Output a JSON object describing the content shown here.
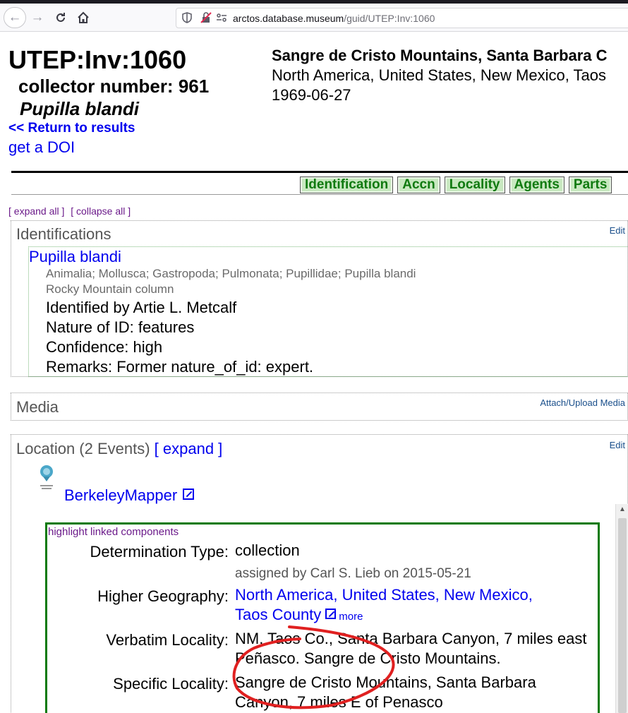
{
  "browser": {
    "url_host": "arctos.database.museum",
    "url_path": "/guid/UTEP:Inv:1060"
  },
  "header": {
    "catalog_number": "UTEP:Inv:1060",
    "collector_number": "collector number: 961",
    "scientific_name": "Pupilla blandi",
    "return_link": "<< Return to results",
    "doi_link": "get a DOI",
    "locality_title": "Sangre de Cristo Mountains, Santa Barbara C",
    "geography": "North America, United States, New Mexico, Taos",
    "date": "1969-06-27"
  },
  "tabs": [
    "Identification",
    "Accn",
    "Locality",
    "Agents",
    "Parts"
  ],
  "expand_all": "[ expand all ]",
  "collapse_all": "[ collapse all ]",
  "identifications": {
    "title": "Identifications",
    "edit": "Edit",
    "name": "Pupilla blandi",
    "taxonomy": "Animalia; Mollusca; Gastropoda; Pulmonata; Pupillidae; Pupilla blandi",
    "common_name": "Rocky Mountain column",
    "identified_by": "Identified by Artie L. Metcalf",
    "nature": "Nature of ID: features",
    "confidence": "Confidence: high",
    "remarks": "Remarks: Former nature_of_id: expert."
  },
  "media": {
    "title": "Media",
    "attach": "Attach/Upload Media"
  },
  "location": {
    "title": "Location (2 Events)",
    "expand": "[ expand ]",
    "edit": "Edit",
    "berkeleymapper": "BerkeleyMapper",
    "highlight": "highlight linked components",
    "rows": {
      "det_type_label": "Determination Type:",
      "det_type_value": "collection",
      "assigned_by": "assigned by Carl S. Lieb on 2015-05-21",
      "higher_geo_label": "Higher Geography:",
      "higher_geo_value_1": "North America, United States, New Mexico,",
      "higher_geo_value_2": "Taos County",
      "more": "more",
      "verbatim_label": "Verbatim Locality:",
      "verbatim_value": "NM, Taos Co., Santa Barbara Canyon, 7 miles east Peñasco. Sangre de Cristo Mountains.",
      "specific_label": "Specific Locality:",
      "specific_value": "Sangre de Cristo Mountains, Santa Barbara Canyon, 7 miles E of Penasco"
    }
  },
  "colors": {
    "link": "#0000ee",
    "tab_bg": "#c8e8c0",
    "tab_text": "#107a10",
    "event_border": "#0a7a0a",
    "annotation": "#e02020"
  }
}
